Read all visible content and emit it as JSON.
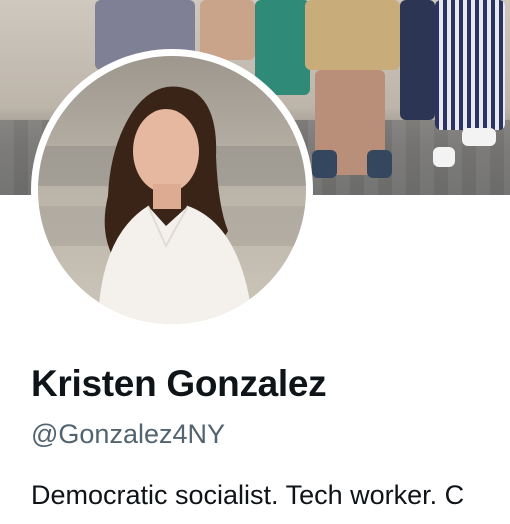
{
  "profile": {
    "display_name": "Kristen Gonzalez",
    "handle": "@Gonzalez4NY",
    "bio": "Democratic socialist. Tech worker. C"
  },
  "colors": {
    "name": "#0f1419",
    "handle": "#536471",
    "background": "#ffffff"
  }
}
